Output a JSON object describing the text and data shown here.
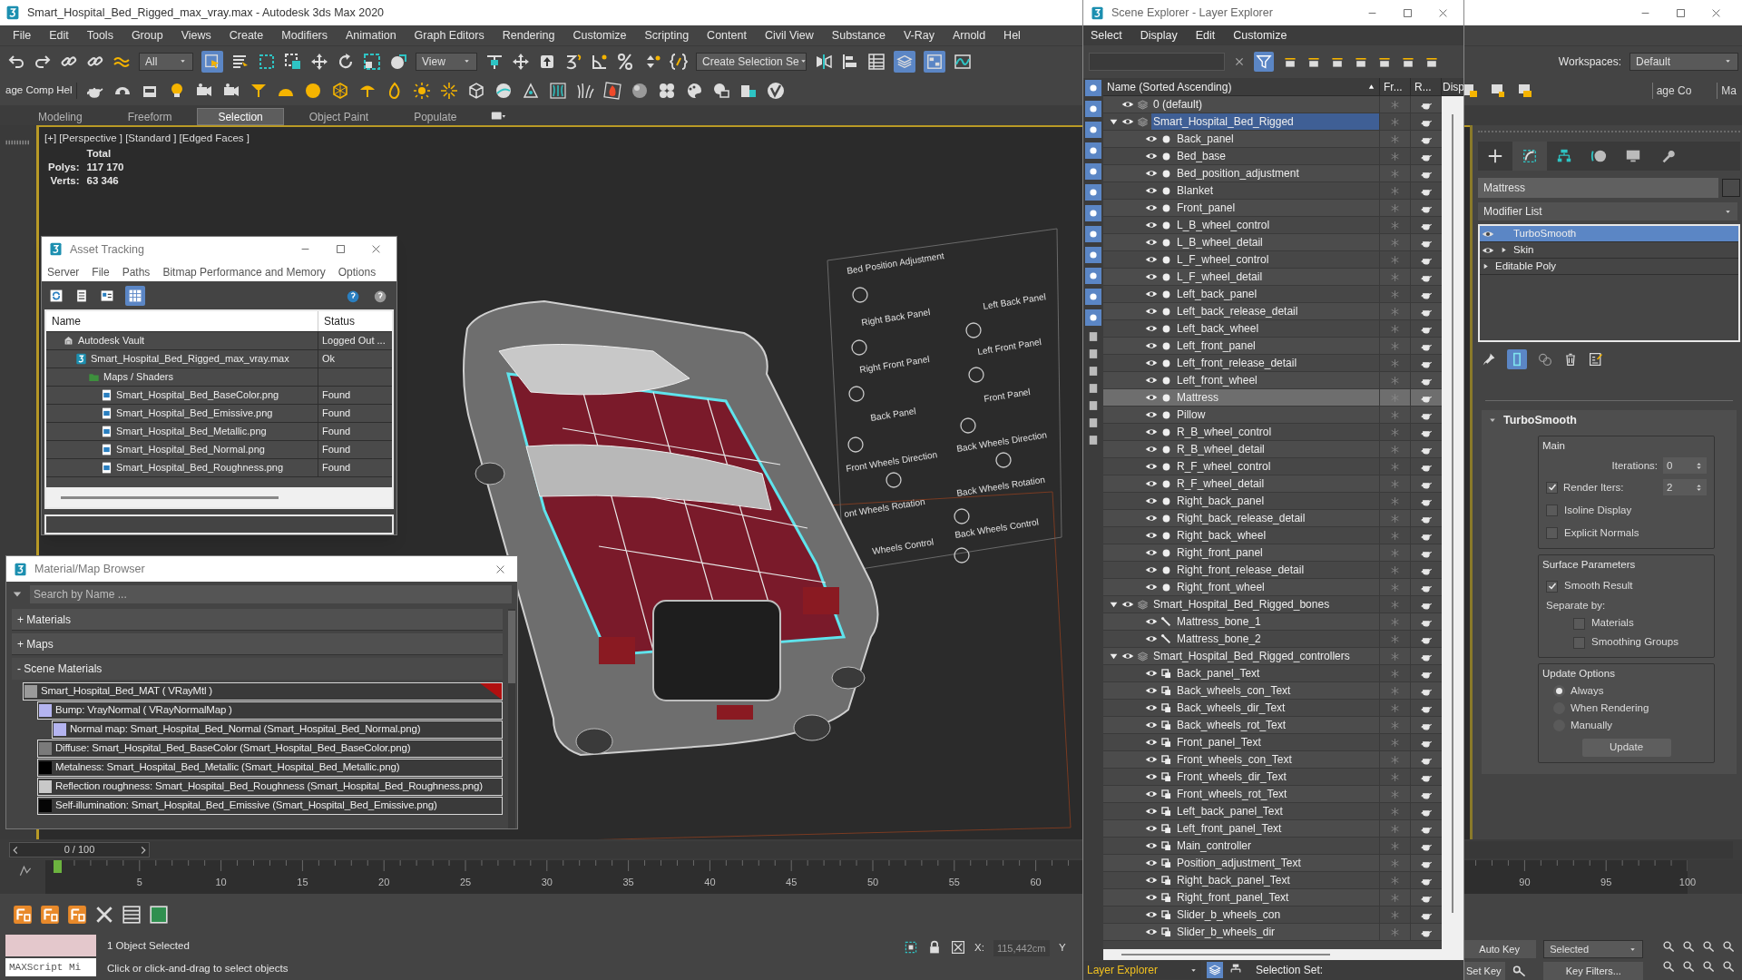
{
  "window": {
    "title": "Smart_Hospital_Bed_Rigged_max_vray.max - Autodesk 3ds Max 2020"
  },
  "menu": [
    "File",
    "Edit",
    "Tools",
    "Group",
    "Views",
    "Create",
    "Modifiers",
    "Animation",
    "Graph Editors",
    "Rendering",
    "Customize",
    "Scripting",
    "Content",
    "Civil View",
    "Substance",
    "V-Ray",
    "Arnold",
    "Hel"
  ],
  "toolbar": {
    "selection_filter": "All",
    "reference_coord": "View",
    "named_selection": "Create Selection Se",
    "workspaces_label": "Workspaces:",
    "workspace": "Default"
  },
  "toolbar_2": {
    "cut_label": "age Comp Hel",
    "right_labels": [
      "age Co",
      "Ma"
    ]
  },
  "ribbon_tabs": [
    {
      "label": "Modeling",
      "selected": false
    },
    {
      "label": "Freeform",
      "selected": false
    },
    {
      "label": "Selection",
      "selected": true
    },
    {
      "label": "Object Paint",
      "selected": false
    },
    {
      "label": "Populate",
      "selected": false
    }
  ],
  "viewport": {
    "label": "[+] [Perspective ] [Standard ] [Edged Faces ]",
    "stats_heading": "Total",
    "stats": [
      {
        "label": "Polys:",
        "value": "117 170"
      },
      {
        "label": "Verts:",
        "value": "63 346"
      }
    ],
    "scene_labels": [
      "Bed Position Adjustment",
      "Left Back Panel",
      "Right Back Panel",
      "Left Front Panel",
      "Right Front Panel",
      "Front Panel",
      "Back Panel",
      "Back Wheels Direction",
      "Front Wheels Direction",
      "Back Wheels Rotation",
      "ont Wheels Rotation",
      "Back Wheels Control",
      "Wheels Control"
    ]
  },
  "asset_tracking": {
    "title": "Asset Tracking",
    "menu": [
      "Server",
      "File",
      "Paths",
      "Bitmap Performance and Memory",
      "Options"
    ],
    "columns": [
      "Name",
      "Status"
    ],
    "items": [
      {
        "kind": "vault",
        "name": "Autodesk Vault",
        "status": "Logged Out ...",
        "children": [
          {
            "kind": "scene",
            "name": "Smart_Hospital_Bed_Rigged_max_vray.max",
            "status": "Ok",
            "children": [
              {
                "kind": "folder",
                "name": "Maps / Shaders",
                "children": [
                  {
                    "kind": "bitmap",
                    "name": "Smart_Hospital_Bed_BaseColor.png",
                    "status": "Found"
                  },
                  {
                    "kind": "bitmap",
                    "name": "Smart_Hospital_Bed_Emissive.png",
                    "status": "Found"
                  },
                  {
                    "kind": "bitmap",
                    "name": "Smart_Hospital_Bed_Metallic.png",
                    "status": "Found"
                  },
                  {
                    "kind": "bitmap",
                    "name": "Smart_Hospital_Bed_Normal.png",
                    "status": "Found"
                  },
                  {
                    "kind": "bitmap",
                    "name": "Smart_Hospital_Bed_Roughness.png",
                    "status": "Found"
                  }
                ]
              }
            ]
          }
        ]
      }
    ]
  },
  "material_browser": {
    "title": "Material/Map Browser",
    "search_placeholder": "Search by Name ...",
    "groups": [
      {
        "label": "+ Materials",
        "expanded": false
      },
      {
        "label": "+ Maps",
        "expanded": false
      },
      {
        "label": "- Scene Materials",
        "expanded": true
      }
    ],
    "materials": [
      {
        "label": "Smart_Hospital_Bed_MAT  ( VRayMtl )",
        "color": "#9a9a9a",
        "children": [
          {
            "label": "Bump: VrayNormal  ( VRayNormalMap )",
            "color": "#b4b4f0",
            "children": [
              {
                "label": "Normal map: Smart_Hospital_Bed_Normal (Smart_Hospital_Bed_Normal.png)",
                "color": "#b4b4f0"
              }
            ]
          },
          {
            "label": "Diffuse: Smart_Hospital_Bed_BaseColor (Smart_Hospital_Bed_BaseColor.png)",
            "color": "#7a7a7a"
          },
          {
            "label": "Metalness: Smart_Hospital_Bed_Metallic (Smart_Hospital_Bed_Metallic.png)",
            "color": "#000000"
          },
          {
            "label": "Reflection roughness: Smart_Hospital_Bed_Roughness (Smart_Hospital_Bed_Roughness.png)",
            "color": "#c8c8c8"
          },
          {
            "label": "Self-illumination: Smart_Hospital_Bed_Emissive (Smart_Hospital_Bed_Emissive.png)",
            "color": "#050505"
          }
        ]
      }
    ]
  },
  "scene_explorer": {
    "title": "Scene Explorer - Layer Explorer",
    "menu": [
      "Select",
      "Display",
      "Edit",
      "Customize"
    ],
    "columns": [
      "Name (Sorted Ascending)",
      "Fr...",
      "R...",
      "Disp"
    ],
    "items": [
      {
        "kind": "layer",
        "name": "0 (default)",
        "selected": false
      },
      {
        "kind": "layer",
        "name": "Smart_Hospital_Bed_Rigged",
        "selected": true,
        "expanded": true,
        "children": [
          {
            "kind": "geometry",
            "name": "Back_panel",
            "selected": false
          },
          {
            "kind": "geometry",
            "name": "Bed_base",
            "selected": false
          },
          {
            "kind": "geometry",
            "name": "Bed_position_adjustment",
            "selected": false
          },
          {
            "kind": "geometry",
            "name": "Blanket",
            "selected": false
          },
          {
            "kind": "geometry",
            "name": "Front_panel",
            "selected": false
          },
          {
            "kind": "geometry",
            "name": "L_B_wheel_control",
            "selected": false
          },
          {
            "kind": "geometry",
            "name": "L_B_wheel_detail",
            "selected": false
          },
          {
            "kind": "geometry",
            "name": "L_F_wheel_control",
            "selected": false
          },
          {
            "kind": "geometry",
            "name": "L_F_wheel_detail",
            "selected": false
          },
          {
            "kind": "geometry",
            "name": "Left_back_panel",
            "selected": false
          },
          {
            "kind": "geometry",
            "name": "Left_back_release_detail",
            "selected": false
          },
          {
            "kind": "geometry",
            "name": "Left_back_wheel",
            "selected": false
          },
          {
            "kind": "geometry",
            "name": "Left_front_panel",
            "selected": false
          },
          {
            "kind": "geometry",
            "name": "Left_front_release_detail",
            "selected": false
          },
          {
            "kind": "geometry",
            "name": "Left_front_wheel",
            "selected": false
          },
          {
            "kind": "geometry",
            "name": "Mattress",
            "selected": true
          },
          {
            "kind": "geometry",
            "name": "Pillow",
            "selected": false
          },
          {
            "kind": "geometry",
            "name": "R_B_wheel_control",
            "selected": false
          },
          {
            "kind": "geometry",
            "name": "R_B_wheel_detail",
            "selected": false
          },
          {
            "kind": "geometry",
            "name": "R_F_wheel_control",
            "selected": false
          },
          {
            "kind": "geometry",
            "name": "R_F_wheel_detail",
            "selected": false
          },
          {
            "kind": "geometry",
            "name": "Right_back_panel",
            "selected": false
          },
          {
            "kind": "geometry",
            "name": "Right_back_release_detail",
            "selected": false
          },
          {
            "kind": "geometry",
            "name": "Right_back_wheel",
            "selected": false
          },
          {
            "kind": "geometry",
            "name": "Right_front_panel",
            "selected": false
          },
          {
            "kind": "geometry",
            "name": "Right_front_release_detail",
            "selected": false
          },
          {
            "kind": "geometry",
            "name": "Right_front_wheel",
            "selected": false
          }
        ]
      },
      {
        "kind": "layer",
        "name": "Smart_Hospital_Bed_Rigged_bones",
        "selected": false,
        "expanded": true,
        "children": [
          {
            "kind": "bone",
            "name": "Mattress_bone_1",
            "selected": false
          },
          {
            "kind": "bone",
            "name": "Mattress_bone_2",
            "selected": false
          }
        ]
      },
      {
        "kind": "layer",
        "name": "Smart_Hospital_Bed_Rigged_controllers",
        "selected": false,
        "expanded": true,
        "children": [
          {
            "kind": "shape",
            "name": "Back_panel_Text",
            "selected": false
          },
          {
            "kind": "shape",
            "name": "Back_wheels_con_Text",
            "selected": false
          },
          {
            "kind": "shape",
            "name": "Back_wheels_dir_Text",
            "selected": false
          },
          {
            "kind": "shape",
            "name": "Back_wheels_rot_Text",
            "selected": false
          },
          {
            "kind": "shape",
            "name": "Front_panel_Text",
            "selected": false
          },
          {
            "kind": "shape",
            "name": "Front_wheels_con_Text",
            "selected": false
          },
          {
            "kind": "shape",
            "name": "Front_wheels_dir_Text",
            "selected": false
          },
          {
            "kind": "shape",
            "name": "Front_wheels_rot_Text",
            "selected": false
          },
          {
            "kind": "shape",
            "name": "Left_back_panel_Text",
            "selected": false
          },
          {
            "kind": "shape",
            "name": "Left_front_panel_Text",
            "selected": false
          },
          {
            "kind": "shape",
            "name": "Main_controller",
            "selected": false
          },
          {
            "kind": "shape",
            "name": "Position_adjustment_Text",
            "selected": false
          },
          {
            "kind": "shape",
            "name": "Right_back_panel_Text",
            "selected": false
          },
          {
            "kind": "shape",
            "name": "Right_front_panel_Text",
            "selected": false
          },
          {
            "kind": "shape",
            "name": "Slider_b_wheels_con",
            "selected": false
          },
          {
            "kind": "shape",
            "name": "Slider_b_wheels_dir",
            "selected": false
          }
        ]
      }
    ],
    "explorer_type": "Layer Explorer",
    "selection_set_label": "Selection Set:"
  },
  "command_panel": {
    "object_name": "Mattress",
    "modifier_list": "Modifier List",
    "stack": [
      {
        "label": "TurboSmooth",
        "selected": true,
        "visible": true,
        "expandable": false
      },
      {
        "label": "Skin",
        "selected": false,
        "visible": true,
        "expandable": true
      },
      {
        "label": "Editable Poly",
        "selected": false,
        "visible": false,
        "expandable": true
      }
    ],
    "rollout_title": "TurboSmooth",
    "groups": [
      {
        "title": "Main",
        "controls": [
          {
            "kind": "spinner",
            "label": "Iterations:",
            "value": "0"
          },
          {
            "kind": "checked_spinner",
            "label": "Render Iters:",
            "value": "2",
            "checked": true
          },
          {
            "kind": "checkbox",
            "label": "Isoline Display",
            "checked": false
          },
          {
            "kind": "checkbox",
            "label": "Explicit Normals",
            "checked": false
          }
        ]
      },
      {
        "title": "Surface Parameters",
        "controls": [
          {
            "kind": "checkbox",
            "label": "Smooth Result",
            "checked": true
          },
          {
            "kind": "text",
            "label": "Separate by:"
          },
          {
            "kind": "sub_checkbox",
            "label": "Materials",
            "checked": false
          },
          {
            "kind": "sub_checkbox",
            "label": "Smoothing Groups",
            "checked": false
          }
        ]
      },
      {
        "title": "Update Options",
        "controls": [
          {
            "kind": "radio",
            "label": "Always",
            "selected": true
          },
          {
            "kind": "radio",
            "label": "When Rendering",
            "selected": false
          },
          {
            "kind": "radio",
            "label": "Manually",
            "selected": false
          },
          {
            "kind": "button",
            "label": "Update"
          }
        ]
      }
    ]
  },
  "timeline": {
    "position": "0 / 100",
    "level": 0,
    "ticks": [
      "5",
      "10",
      "15",
      "20",
      "25",
      "30",
      "35",
      "40",
      "45",
      "50",
      "55",
      "60",
      "90",
      "95",
      "100"
    ]
  },
  "status": {
    "listener": "MAXScript Mi",
    "selection": "1 Object Selected",
    "prompt": "Click or click-and-drag to select objects",
    "x_label": "X:",
    "x_value": "115,442cm",
    "y_label": "Y",
    "auto_key": "Auto Key",
    "key_mode": "Selected",
    "set_key": "Set Key",
    "key_filters": "Key Filters..."
  }
}
